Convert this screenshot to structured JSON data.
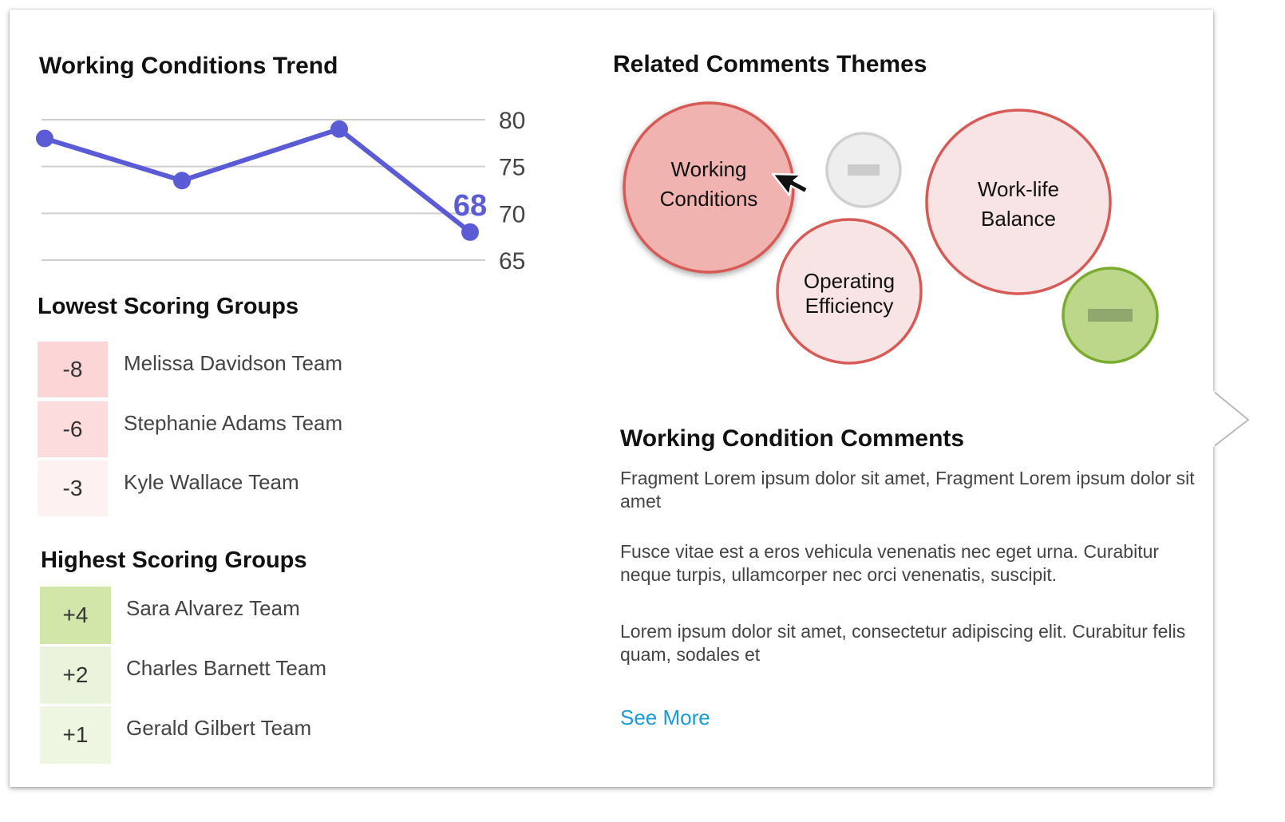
{
  "trend": {
    "title": "Working Conditions Trend",
    "callout": "68",
    "accent": "#5b5bd6"
  },
  "chart_data": {
    "type": "line",
    "title": "Working Conditions Trend",
    "x": [
      1,
      2,
      3,
      4
    ],
    "values": [
      78,
      73.5,
      79,
      68
    ],
    "y_ticks": [
      "80",
      "75",
      "70",
      "65"
    ],
    "ylim": [
      65,
      80
    ],
    "grid": true,
    "y_axis_position": "right",
    "annotation": {
      "index": 3,
      "text": "68"
    }
  },
  "lowest": {
    "title": "Lowest Scoring Groups",
    "groups": [
      {
        "score": "-8",
        "name": "Melissa Davidson Team",
        "color": "#fcd6d6"
      },
      {
        "score": "-6",
        "name": "Stephanie Adams Team",
        "color": "#fcdcdc"
      },
      {
        "score": "-3",
        "name": "Kyle Wallace Team",
        "color": "#fdf1f1"
      }
    ]
  },
  "highest": {
    "title": "Highest Scoring Groups",
    "groups": [
      {
        "score": "+4",
        "name": "Sara Alvarez Team",
        "color": "#d3e6a9"
      },
      {
        "score": "+2",
        "name": "Charles Barnett Team",
        "color": "#eaf3dc"
      },
      {
        "score": "+1",
        "name": "Gerald Gilbert Team",
        "color": "#eef5e1"
      }
    ]
  },
  "themes": {
    "title": "Related Comments Themes",
    "bubbles": [
      {
        "name": "Working Conditions",
        "lines": [
          "Working",
          "Conditions"
        ],
        "fill": "#f0b3b0",
        "stroke": "#d65a55",
        "selected": true
      },
      {
        "name": "Operating Efficiency",
        "lines": [
          "Operating",
          "Efficiency"
        ],
        "fill": "#f8e4e4",
        "stroke": "#d65a55"
      },
      {
        "name": "Work-life Balance",
        "lines": [
          "Work-life",
          "Balance"
        ],
        "fill": "#f8e4e4",
        "stroke": "#d65a55"
      },
      {
        "name": "neutral",
        "lines": [],
        "fill": "#eeeeee",
        "stroke": "#d0d0d0"
      },
      {
        "name": "positive",
        "lines": [],
        "fill": "#bcd68a",
        "stroke": "#7aab2e"
      }
    ]
  },
  "comments": {
    "title": "Working Condition Comments",
    "items": [
      "Fragment  Lorem ipsum dolor sit amet, Fragment  Lorem ipsum dolor sit amet",
      "Fusce vitae est a eros vehicula venenatis nec eget urna. Curabitur neque turpis, ullamcorper nec orci venenatis, suscipit.",
      "Lorem ipsum dolor sit amet, consectetur adipiscing elit. Curabitur felis quam, sodales et"
    ],
    "see_more": "See More",
    "link_color": "#1a9ad6"
  }
}
